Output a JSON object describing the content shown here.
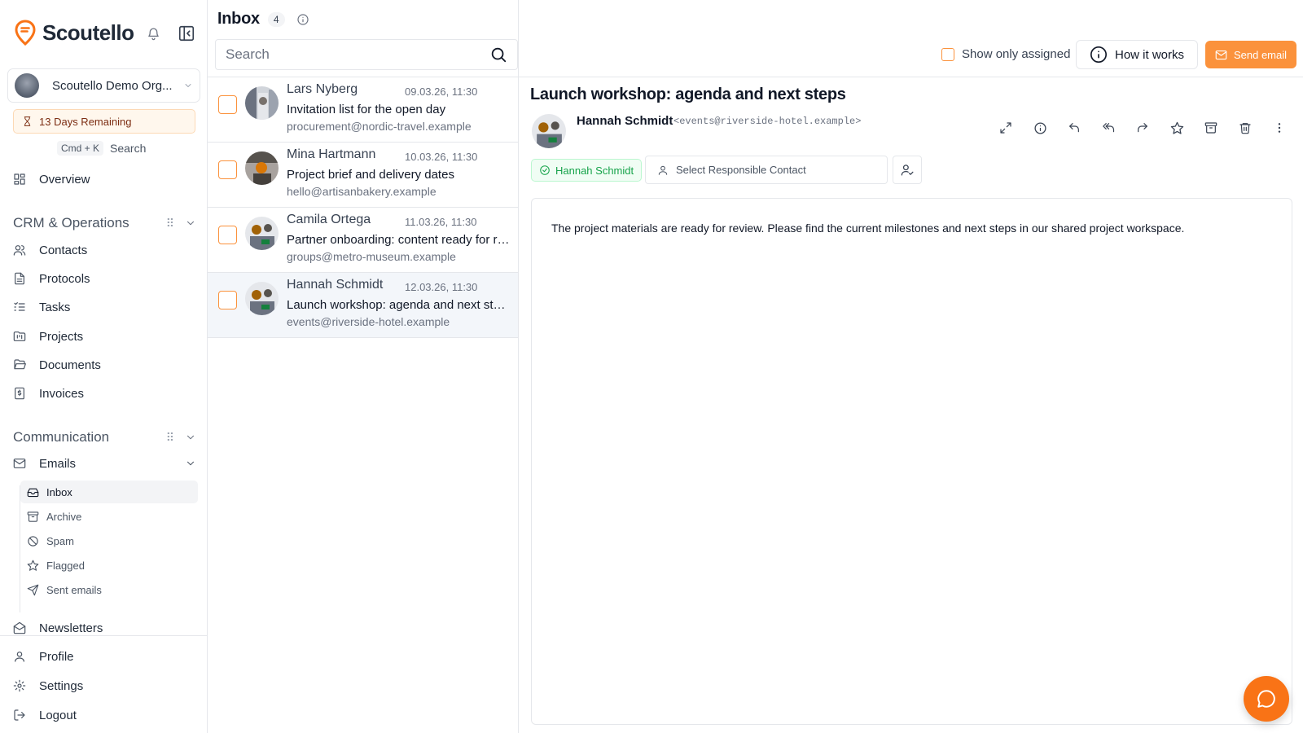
{
  "app": {
    "name": "Scoutello",
    "brand_color": "#f97316"
  },
  "sidebar": {
    "org_name": "Scoutello Demo Org...",
    "trial_text": "13 Days Remaining",
    "search_shortcut": "Cmd + K",
    "search_label": "Search",
    "overview": "Overview",
    "sections": [
      {
        "title": "CRM & Operations",
        "items": [
          "Contacts",
          "Protocols",
          "Tasks",
          "Projects",
          "Documents",
          "Invoices"
        ]
      },
      {
        "title": "Communication"
      }
    ],
    "emails": {
      "label": "Emails",
      "sub": [
        "Inbox",
        "Archive",
        "Spam",
        "Flagged",
        "Sent emails"
      ]
    },
    "newsletters": "Newsletters",
    "footer": [
      "Profile",
      "Settings",
      "Logout"
    ]
  },
  "inbox": {
    "title": "Inbox",
    "count": "4",
    "search_placeholder": "Search",
    "messages": [
      {
        "name": "Lars Nyberg",
        "date": "09.03.26, 11:30",
        "subject": "Invitation list for the open day",
        "email": "procurement@nordic-travel.example"
      },
      {
        "name": "Mina Hartmann",
        "date": "10.03.26, 11:30",
        "subject": "Project brief and delivery dates",
        "email": "hello@artisanbakery.example"
      },
      {
        "name": "Camila Ortega",
        "date": "11.03.26, 11:30",
        "subject": "Partner onboarding: content ready for review",
        "email": "groups@metro-museum.example"
      },
      {
        "name": "Hannah Schmidt",
        "date": "12.03.26, 11:30",
        "subject": "Launch workshop: agenda and next steps",
        "email": "events@riverside-hotel.example"
      }
    ]
  },
  "toolbar": {
    "show_assigned": "Show only assigned",
    "how_it_works": "How it works",
    "send_email": "Send email"
  },
  "detail": {
    "subject": "Launch workshop: agenda and next steps",
    "sender_name": "Hannah Schmidt",
    "sender_email": "<events@riverside-hotel.example>",
    "contact_chip": "Hannah Schmidt",
    "responsible_placeholder": "Select Responsible Contact",
    "body": "The project materials are ready for review. Please find the current milestones and next steps in our shared project workspace.",
    "actions": [
      "expand-icon",
      "info-icon",
      "reply-icon",
      "reply-all-icon",
      "forward-icon",
      "star-icon",
      "archive-icon",
      "trash-icon",
      "more-icon"
    ]
  }
}
